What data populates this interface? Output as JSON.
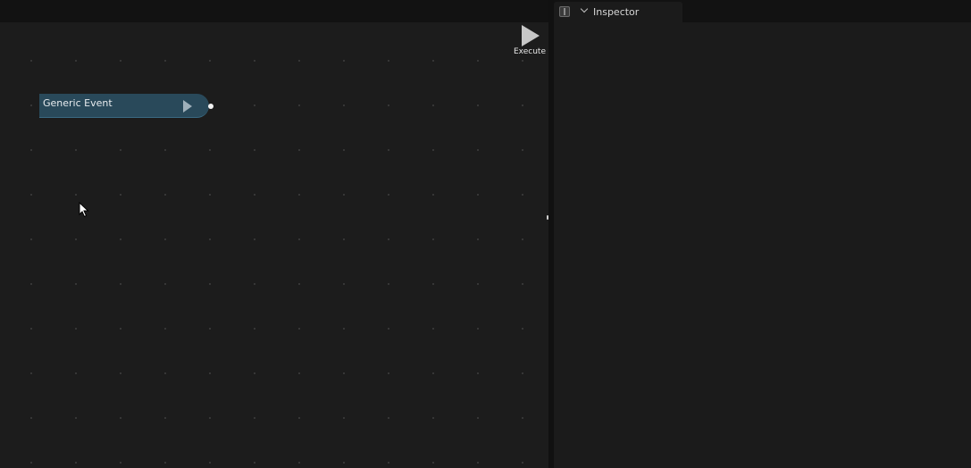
{
  "toolbar": {
    "execute_label": "Execute"
  },
  "graph": {
    "nodes": [
      {
        "title": "Generic Event",
        "color": "#29495a"
      }
    ]
  },
  "inspector": {
    "tab_label": "Inspector"
  },
  "colors": {
    "background": "#1b1b1b",
    "node": "#29495a",
    "grid_dot": "#3a3a3a"
  }
}
